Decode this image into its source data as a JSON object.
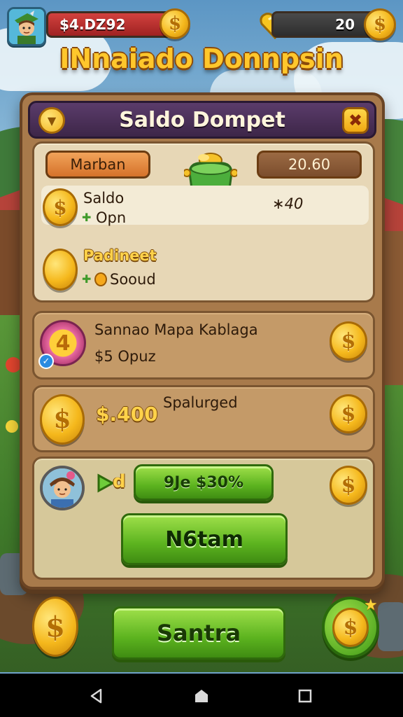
{
  "hud": {
    "money_value": "$4.DZ92",
    "gems_value": "20"
  },
  "game_title": "INnaiado Donnpsin",
  "panel": {
    "title": "Saldo Dompet",
    "tab_label": "Marban",
    "tab_value": "20.60",
    "saldo_label": "Saldo",
    "saldo_sub": "Opn",
    "saldo_amount": "40",
    "pending_label": "Padineet",
    "pending_sub": "Sooud"
  },
  "mission": {
    "badge_number": "4",
    "title": "Sannao Mapa Kablaga",
    "reward": "$5 Opuz"
  },
  "bonus": {
    "amount": "$.400",
    "label": "Spalurged"
  },
  "claim": {
    "arrow_label": "d",
    "offer_button": "9Je $30%",
    "main_button": "N6tam"
  },
  "footer": {
    "start_button": "Santra"
  },
  "nav": [
    "back",
    "home",
    "recents"
  ]
}
